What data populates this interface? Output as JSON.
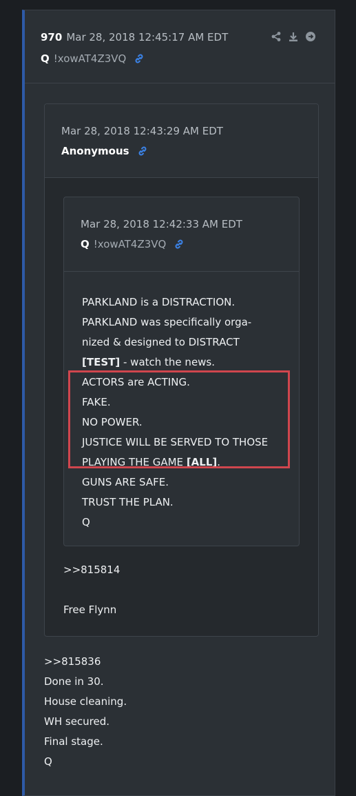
{
  "post": {
    "number": "970",
    "date": "Mar 28, 2018 12:45:17 AM EDT",
    "author": "Q",
    "tripcode": "!xowAT4Z3VQ",
    "icons": [
      "share-icon",
      "download-icon",
      "arrow-right-circle-icon",
      "link-icon"
    ],
    "body_lines": [
      ">>815836",
      "Done in 30.",
      "House cleaning.",
      "WH secured.",
      "Final stage.",
      "Q"
    ]
  },
  "quoted": {
    "date": "Mar 28, 2018 12:43:29 AM EDT",
    "author": "Anonymous",
    "reply_ref": ">>815814",
    "text": "Free Flynn"
  },
  "nested": {
    "date": "Mar 28, 2018 12:42:33 AM EDT",
    "author": "Q",
    "tripcode": "!xowAT4Z3VQ",
    "lines": [
      {
        "text": "PARKLAND is a DISTRACTION.",
        "bold": ""
      },
      {
        "text": "PARKLAND was specifically orga-",
        "bold": ""
      },
      {
        "text": "nized & designed to DISTRACT",
        "bold": ""
      },
      {
        "text": " - watch the news.",
        "bold": "[TEST]"
      },
      {
        "text": "ACTORS are ACTING.",
        "bold": ""
      },
      {
        "text": "FAKE.",
        "bold": ""
      },
      {
        "text": "NO POWER.",
        "bold": ""
      },
      {
        "text": "JUSTICE WILL BE SERVED TO THOSE",
        "bold": ""
      },
      {
        "text": "PLAYING THE GAME ",
        "bold": "[ALL]",
        "after": "."
      },
      {
        "text": "GUNS ARE SAFE.",
        "bold": ""
      },
      {
        "text": "TRUST THE PLAN.",
        "bold": ""
      },
      {
        "text": "Q",
        "bold": ""
      }
    ]
  },
  "colors": {
    "accent": "#2e5aa7",
    "link": "#3b82e6",
    "highlight": "#d0464e"
  }
}
